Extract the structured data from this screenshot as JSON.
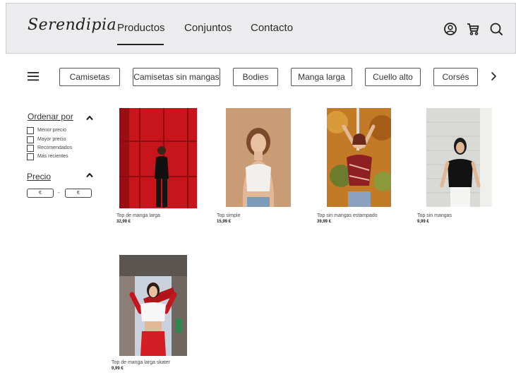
{
  "header": {
    "logo": "Serendipia",
    "nav": [
      {
        "label": "Productos",
        "active": true
      },
      {
        "label": "Conjuntos",
        "active": false
      },
      {
        "label": "Contacto",
        "active": false
      }
    ],
    "icons": [
      "account-icon",
      "cart-icon",
      "search-icon"
    ]
  },
  "categories": [
    "Camisetas",
    "Camisetas sin mangas",
    "Bodies",
    "Manga larga",
    "Cuello alto",
    "Corsés"
  ],
  "filters": {
    "sort_title": "Ordenar por",
    "sort_options": [
      "Menor precio",
      "Mayor precio",
      "Recomendados",
      "Más recientes"
    ],
    "price_title": "Precio",
    "price_min_placeholder": "€",
    "price_max_placeholder": "€",
    "price_separator": "-"
  },
  "products": [
    {
      "name": "Top de manga larga",
      "price": "32,99 €"
    },
    {
      "name": "Top simple",
      "price": "15,99 €"
    },
    {
      "name": "Top sin mangas estampado",
      "price": "39,99 €"
    },
    {
      "name": "Top sin mangas",
      "price": "9,99 €"
    },
    {
      "name": "Top de manga larga skater",
      "price": "9,99 €"
    }
  ],
  "colors": {
    "header_bg": "#ececee",
    "text": "#222222",
    "chip_border": "#555555"
  }
}
